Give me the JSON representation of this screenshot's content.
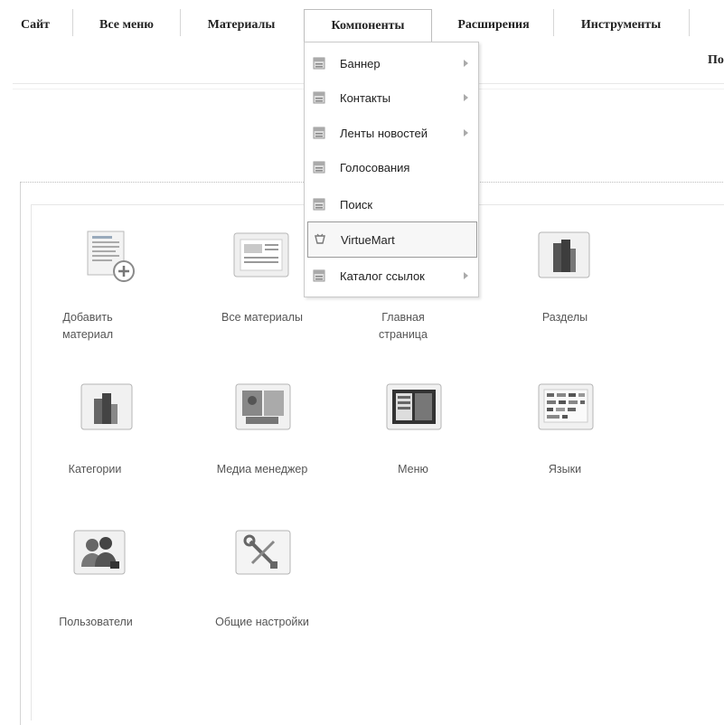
{
  "menu": {
    "items": [
      {
        "label": "Сайт"
      },
      {
        "label": "Все меню"
      },
      {
        "label": "Материалы"
      },
      {
        "label": "Компоненты"
      },
      {
        "label": "Расширения"
      },
      {
        "label": "Инструменты"
      }
    ],
    "header_right": "По"
  },
  "dropdown": {
    "items": [
      {
        "label": "Баннер",
        "submenu": true
      },
      {
        "label": "Контакты",
        "submenu": true
      },
      {
        "label": "Ленты новостей",
        "submenu": true
      },
      {
        "label": "Голосования",
        "submenu": false
      },
      {
        "label": "Поиск",
        "submenu": false
      },
      {
        "label": "VirtueMart",
        "submenu": false,
        "highlighted": true
      },
      {
        "label": "Каталог ссылок",
        "submenu": true
      }
    ]
  },
  "panel": {
    "icons": [
      {
        "label": "Добавить материал",
        "icon": "add-article-icon"
      },
      {
        "label": "Все материалы",
        "icon": "articles-icon"
      },
      {
        "label": "Главная страница",
        "icon": "frontpage-icon"
      },
      {
        "label": "Разделы",
        "icon": "sections-icon"
      },
      {
        "label": "Категории",
        "icon": "categories-icon"
      },
      {
        "label": "Медиа менеджер",
        "icon": "media-manager-icon"
      },
      {
        "label": "Меню",
        "icon": "menu-icon"
      },
      {
        "label": "Языки",
        "icon": "languages-icon"
      },
      {
        "label": "Пользователи",
        "icon": "users-icon"
      },
      {
        "label": "Общие настройки",
        "icon": "settings-icon"
      }
    ]
  }
}
